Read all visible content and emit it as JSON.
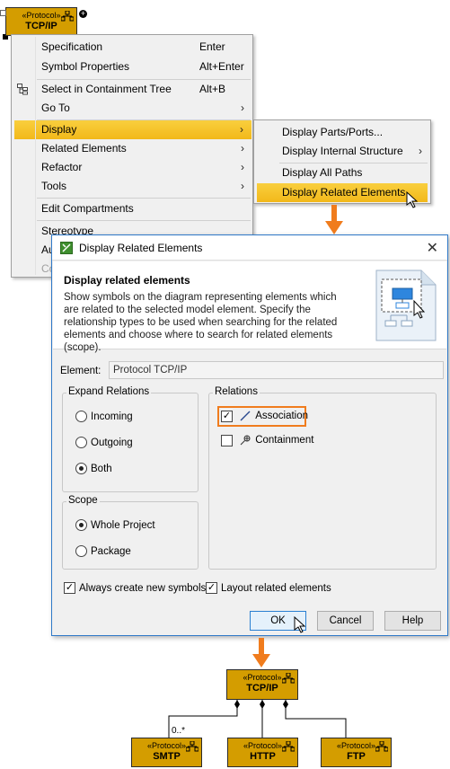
{
  "top_element": {
    "stereotype": "«Protocol»",
    "name": "TCP/IP"
  },
  "context_menu": {
    "items": [
      {
        "label": "Specification",
        "shortcut": "Enter"
      },
      {
        "label": "Symbol Properties",
        "shortcut": "Alt+Enter"
      },
      {
        "label": "Select in Containment Tree",
        "shortcut": "Alt+B"
      },
      {
        "label": "Go To"
      },
      {
        "label": "Display"
      },
      {
        "label": "Related Elements"
      },
      {
        "label": "Refactor"
      },
      {
        "label": "Tools"
      },
      {
        "label": "Edit Compartments"
      },
      {
        "label": "Stereotype"
      },
      {
        "label": "Au"
      },
      {
        "label": "Co"
      }
    ]
  },
  "submenu": {
    "items": [
      {
        "label": "Display Parts/Ports..."
      },
      {
        "label": "Display Internal Structure"
      },
      {
        "label": "Display All Paths"
      },
      {
        "label": "Display Related Elements"
      }
    ]
  },
  "dialog": {
    "title": "Display Related Elements",
    "heading": "Display related elements",
    "description": "Show symbols on the diagram representing elements which are related to the selected model element. Specify the relationship types to be used when searching for the related elements and choose where to search for related elements (scope).",
    "element_label": "Element:",
    "element_value": "Protocol TCP/IP",
    "expand_group": {
      "label": "Expand Relations",
      "options": [
        "Incoming",
        "Outgoing",
        "Both"
      ],
      "selected": "Both"
    },
    "scope_group": {
      "label": "Scope",
      "options": [
        "Whole Project",
        "Package"
      ],
      "selected": "Whole Project"
    },
    "relations_group": {
      "label": "Relations",
      "items": [
        {
          "label": "Association",
          "checked": true
        },
        {
          "label": "Containment",
          "checked": false
        }
      ]
    },
    "always_create": "Always create new symbols",
    "layout_related": "Layout related elements",
    "ok": "OK",
    "cancel": "Cancel",
    "help": "Help"
  },
  "result_diagram": {
    "parent": {
      "stereotype": "«Protocol»",
      "name": "TCP/IP"
    },
    "multiplicity": "0..*",
    "children": [
      {
        "stereotype": "«Protocol»",
        "name": "SMTP"
      },
      {
        "stereotype": "«Protocol»",
        "name": "HTTP"
      },
      {
        "stereotype": "«Protocol»",
        "name": "FTP"
      }
    ]
  },
  "colors": {
    "protocol_fill": "#d49d00",
    "highlight": "#f7c52a",
    "callout": "#f07c1d",
    "dialog_border": "#2f79c8"
  }
}
